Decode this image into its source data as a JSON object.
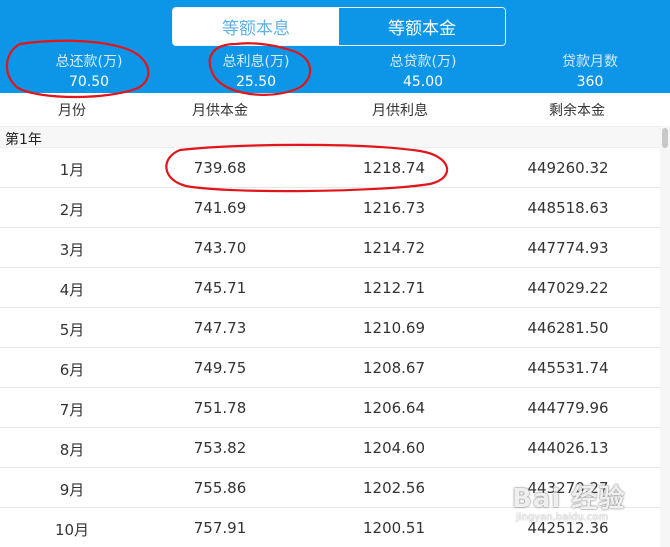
{
  "tabs": [
    {
      "label": "等额本息"
    },
    {
      "label": "等额本金"
    }
  ],
  "summary": [
    {
      "label": "总还款(万)",
      "value": "70.50"
    },
    {
      "label": "总利息(万)",
      "value": "25.50"
    },
    {
      "label": "总贷款(万)",
      "value": "45.00"
    },
    {
      "label": "贷款月数",
      "value": "360"
    }
  ],
  "columns": [
    "月份",
    "月供本金",
    "月供利息",
    "剩余本金"
  ],
  "year_label": "第1年",
  "rows": [
    [
      "1月",
      "739.68",
      "1218.74",
      "449260.32"
    ],
    [
      "2月",
      "741.69",
      "1216.73",
      "448518.63"
    ],
    [
      "3月",
      "743.70",
      "1214.72",
      "447774.93"
    ],
    [
      "4月",
      "745.71",
      "1212.71",
      "447029.22"
    ],
    [
      "5月",
      "747.73",
      "1210.69",
      "446281.50"
    ],
    [
      "6月",
      "749.75",
      "1208.67",
      "445531.74"
    ],
    [
      "7月",
      "751.78",
      "1206.64",
      "444779.96"
    ],
    [
      "8月",
      "753.82",
      "1204.60",
      "444026.13"
    ],
    [
      "9月",
      "755.86",
      "1202.56",
      "443270.27"
    ],
    [
      "10月",
      "757.91",
      "1200.51",
      "442512.36"
    ]
  ],
  "watermark": {
    "text": "Bai 经验",
    "sub": "jingyan.baidu.com"
  },
  "colors": {
    "header_bg": "#0d96e8",
    "annotation": "#e0161a"
  }
}
